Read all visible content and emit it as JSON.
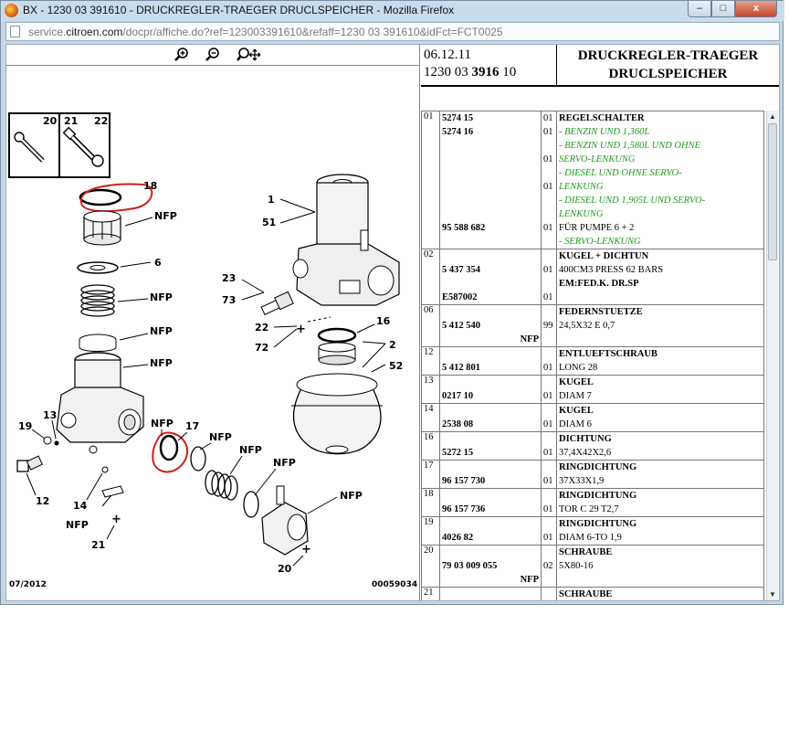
{
  "window": {
    "title": "BX - 1230 03 391610 - DRUCKREGLER-TRAEGER DRUCLSPEICHER - Mozilla Firefox",
    "min_label": "–",
    "max_label": "□",
    "close_label": "x",
    "url_prefix": "service.",
    "url_domain": "citroen.com",
    "url_suffix": "/docpr/affiche.do?ref=123003391610&refaff=1230 03 391610&idFct=FCT0025"
  },
  "zoom_controls": [
    {
      "name": "zoom-in-icon"
    },
    {
      "name": "zoom-out-icon"
    },
    {
      "name": "pan-zoom-icon"
    }
  ],
  "diagram": {
    "kit_numbers": [
      "20",
      "21",
      "22"
    ],
    "callouts": {
      "c18": "18",
      "c1": "1",
      "c51": "51",
      "c6": "6",
      "c23": "23",
      "c73": "73",
      "c22": "22",
      "c72": "72",
      "c16": "16",
      "c2": "2",
      "c52": "52",
      "c19": "19",
      "c13": "13",
      "c12": "12",
      "c14": "14",
      "c21": "21",
      "c17": "17",
      "c20": "20"
    },
    "nfp": "NFP",
    "footer_date": "07/2012",
    "footer_code": "00059034"
  },
  "header": {
    "date": "06.12.11",
    "ref_prefix": "1230 03 ",
    "ref_bold": "3916",
    "ref_suffix": " 10",
    "title_line1": "DRUCKREGLER-TRAEGER",
    "title_line2": "DRUCLSPEICHER"
  },
  "parts": [
    {
      "no": "01",
      "lines": [
        {
          "ref": "5274 15",
          "qty": "01"
        },
        {
          "ref": "5274 16",
          "qty": "01"
        },
        {
          "ref": "",
          "qty": ""
        },
        {
          "ref": "",
          "qty": "01"
        },
        {
          "ref": "",
          "qty": ""
        },
        {
          "ref": "",
          "qty": "01"
        },
        {
          "ref": "",
          "qty": ""
        },
        {
          "ref": "",
          "qty": ""
        },
        {
          "ref": "95 588 682",
          "qty": "01"
        }
      ],
      "desc": [
        {
          "text": "REGELSCHALTER",
          "style": "title"
        },
        {
          "text": "- BENZIN UND 1,360L",
          "style": "green"
        },
        {
          "text": "- BENZIN UND 1,580L UND OHNE",
          "style": "green"
        },
        {
          "text": "SERVO-LENKUNG",
          "style": "green"
        },
        {
          "text": "- DIESEL UND OHNE SERVO-",
          "style": "green"
        },
        {
          "text": "LENKUNG",
          "style": "green"
        },
        {
          "text": "- DIESEL UND 1,905L UND SERVO-",
          "style": "green"
        },
        {
          "text": "LENKUNG",
          "style": "green"
        },
        {
          "text": "FÜR PUMPE 6 + 2",
          "style": "plain"
        },
        {
          "text": "- SERVO-LENKUNG",
          "style": "green"
        }
      ]
    },
    {
      "no": "02",
      "lines": [
        {
          "ref": "",
          "qty": ""
        },
        {
          "ref": "5 437 354",
          "qty": "01"
        },
        {
          "ref": "",
          "qty": ""
        },
        {
          "ref": "E587002",
          "qty": "01"
        }
      ],
      "desc": [
        {
          "text": "KUGEL + DICHTUN",
          "style": "title"
        },
        {
          "text": "400CM3 PRESS 62 BARS",
          "style": "plain"
        },
        {
          "text": "EM:FED.K. DR.SP",
          "style": "bold"
        }
      ]
    },
    {
      "no": "06",
      "lines": [
        {
          "ref": "",
          "qty": ""
        },
        {
          "ref": "5 412 540",
          "qty": "99"
        },
        {
          "ref": "",
          "qty": "",
          "nfp": "NFP"
        }
      ],
      "desc": [
        {
          "text": "FEDERNSTUETZE",
          "style": "title"
        },
        {
          "text": "24,5X32 E 0,7",
          "style": "plain"
        }
      ]
    },
    {
      "no": "12",
      "lines": [
        {
          "ref": "",
          "qty": ""
        },
        {
          "ref": "5 412 801",
          "qty": "01"
        }
      ],
      "desc": [
        {
          "text": "ENTLUEFTSCHRAUB",
          "style": "title"
        },
        {
          "text": "LONG 28",
          "style": "plain"
        }
      ]
    },
    {
      "no": "13",
      "lines": [
        {
          "ref": "",
          "qty": ""
        },
        {
          "ref": "0217 10",
          "qty": "01"
        }
      ],
      "desc": [
        {
          "text": "KUGEL",
          "style": "title"
        },
        {
          "text": "DIAM 7",
          "style": "plain"
        }
      ]
    },
    {
      "no": "14",
      "lines": [
        {
          "ref": "",
          "qty": ""
        },
        {
          "ref": "2538 08",
          "qty": "01"
        }
      ],
      "desc": [
        {
          "text": "KUGEL",
          "style": "title"
        },
        {
          "text": "DIAM 6",
          "style": "plain"
        }
      ]
    },
    {
      "no": "16",
      "lines": [
        {
          "ref": "",
          "qty": ""
        },
        {
          "ref": "5272 15",
          "qty": "01"
        }
      ],
      "desc": [
        {
          "text": "DICHTUNG",
          "style": "title"
        },
        {
          "text": "37,4X42X2,6",
          "style": "plain"
        }
      ]
    },
    {
      "no": "17",
      "lines": [
        {
          "ref": "",
          "qty": ""
        },
        {
          "ref": "96 157 730",
          "qty": "01"
        }
      ],
      "desc": [
        {
          "text": "RINGDICHTUNG",
          "style": "title"
        },
        {
          "text": "37X33X1,9",
          "style": "plain"
        }
      ]
    },
    {
      "no": "18",
      "lines": [
        {
          "ref": "",
          "qty": ""
        },
        {
          "ref": "96 157 736",
          "qty": "01"
        }
      ],
      "desc": [
        {
          "text": "RINGDICHTUNG",
          "style": "title"
        },
        {
          "text": "TOR C 29 T2,7",
          "style": "plain"
        }
      ]
    },
    {
      "no": "19",
      "lines": [
        {
          "ref": "",
          "qty": ""
        },
        {
          "ref": "4026 82",
          "qty": "01"
        }
      ],
      "desc": [
        {
          "text": "RINGDICHTUNG",
          "style": "title"
        },
        {
          "text": "DIAM 6-TO 1,9",
          "style": "plain"
        }
      ]
    },
    {
      "no": "20",
      "lines": [
        {
          "ref": "",
          "qty": ""
        },
        {
          "ref": "79 03 009 055",
          "qty": "02"
        },
        {
          "ref": "",
          "qty": "",
          "nfp": "NFP"
        }
      ],
      "desc": [
        {
          "text": "SCHRAUBE",
          "style": "title"
        },
        {
          "text": "5X80-16",
          "style": "plain"
        }
      ]
    },
    {
      "no": "21",
      "lines": [
        {
          "ref": "",
          "qty": ""
        }
      ],
      "desc": [
        {
          "text": "SCHRAUBE",
          "style": "title"
        }
      ]
    }
  ],
  "colors": {
    "green_text": "#1f9a1f",
    "highlight": "#cc1f1f"
  }
}
